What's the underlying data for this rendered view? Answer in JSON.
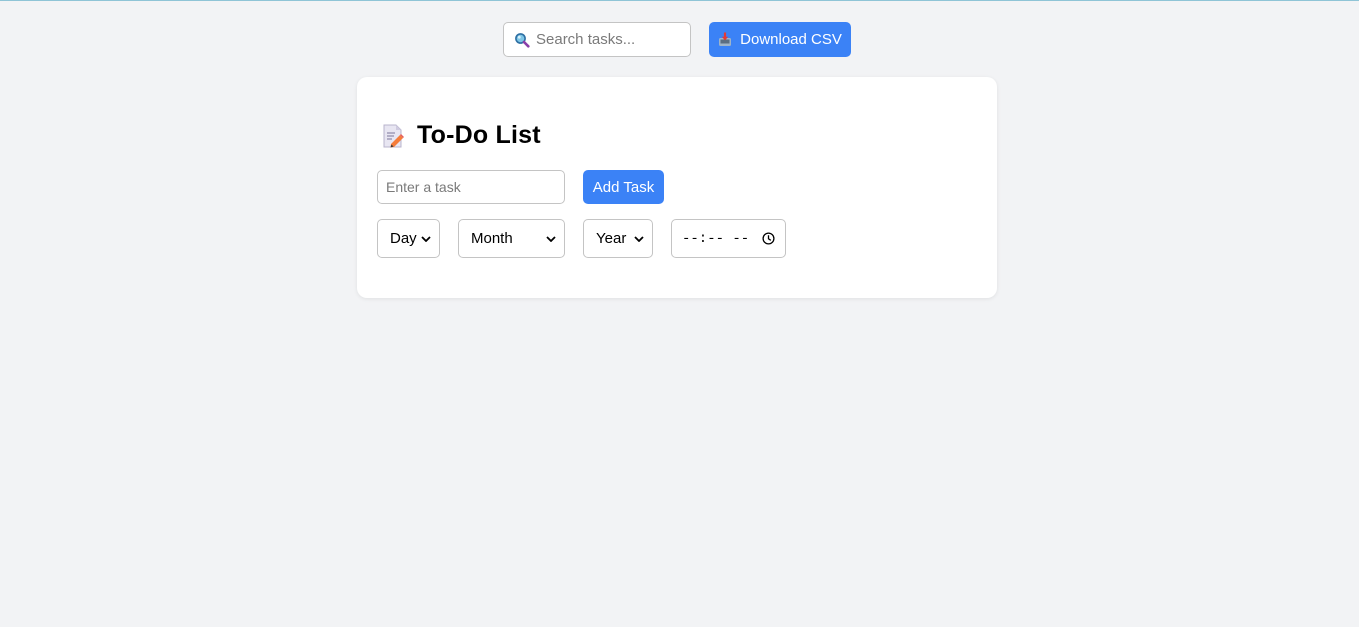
{
  "toolbar": {
    "search_placeholder": "Search tasks...",
    "search_icon": "magnifier-icon",
    "download_label": "Download CSV",
    "download_icon": "inbox-tray-icon"
  },
  "todo": {
    "title": "To-Do List",
    "title_icon": "memo-icon",
    "task_placeholder": "Enter a task",
    "add_label": "Add Task",
    "day_label": "Day",
    "month_label": "Month",
    "year_label": "Year",
    "time_value": "--:-- --"
  },
  "colors": {
    "accent": "#3b82f6",
    "background": "#f2f3f5",
    "card": "#ffffff",
    "border": "#c4c4c4"
  }
}
